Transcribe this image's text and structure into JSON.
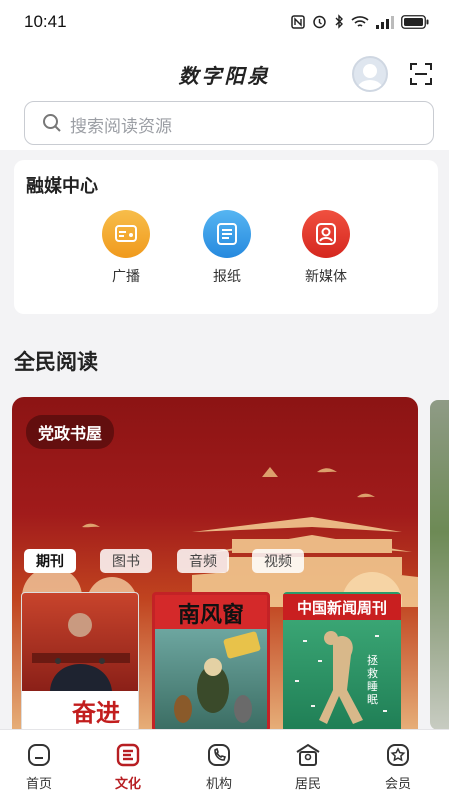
{
  "status_bar": {
    "time": "10:41"
  },
  "header": {
    "title": "数字阳泉"
  },
  "search": {
    "placeholder": "搜索阅读资源"
  },
  "media_center": {
    "title": "融媒中心",
    "items": [
      {
        "label": "广播",
        "icon": "radio-icon",
        "color": "#f5a623"
      },
      {
        "label": "报纸",
        "icon": "newspaper-icon",
        "color": "#2d9be8"
      },
      {
        "label": "新媒体",
        "icon": "new-media-icon",
        "color": "#e5362c"
      }
    ]
  },
  "reading": {
    "title": "全民阅读",
    "banner_tag": "党政书屋",
    "chips": [
      "期刊",
      "图书",
      "音频",
      "视频"
    ],
    "active_chip": "期刊",
    "books": [
      {
        "title": "奋进"
      },
      {
        "title": "南风窗"
      },
      {
        "title": "中国新闻周刊",
        "subtitle": "拯救睡眠"
      }
    ]
  },
  "tabbar": {
    "active": "文化",
    "items": [
      {
        "label": "首页",
        "icon": "home-icon"
      },
      {
        "label": "文化",
        "icon": "culture-icon"
      },
      {
        "label": "机构",
        "icon": "institution-icon"
      },
      {
        "label": "居民",
        "icon": "resident-icon"
      },
      {
        "label": "会员",
        "icon": "member-icon"
      }
    ]
  },
  "colors": {
    "accent": "#b71e22",
    "banner_red": "#9c1818"
  }
}
